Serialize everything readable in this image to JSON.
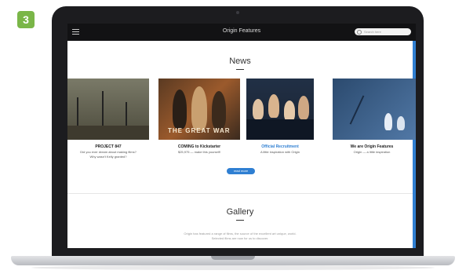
{
  "step_badge": "3",
  "app": {
    "brand": "Origin Features",
    "search_placeholder": "Search here"
  },
  "news": {
    "heading": "News",
    "read_more": "read more",
    "cards": [
      {
        "title": "PROJECT 847",
        "subtitle_1": "Did you ever dream about making films?",
        "subtitle_2": "Why wasn't Kelly granted?",
        "image_icon": "film-still-icon"
      },
      {
        "title": "COMING to Kickstarter",
        "subtitle_1": "$25,975 — make this yourself!",
        "subtitle_2": "",
        "image_icon": "film-poster-icon",
        "image_text": "THE GREAT WAR"
      },
      {
        "title": "Official Recruitment",
        "subtitle_1": "A little inspiration with Origin",
        "subtitle_2": "",
        "image_icon": "audience-photo-icon"
      },
      {
        "title": "We are Origin Features",
        "subtitle_1": "Origin — a little inspiration",
        "subtitle_2": "",
        "image_icon": "film-crew-icon"
      }
    ]
  },
  "gallery": {
    "heading": "Gallery",
    "text_1": "Origin has featured a range of films, the source of the excellent art unique, world.",
    "text_2": "Selected films are now for us to discover."
  },
  "colors": {
    "accent": "#2f7fd2",
    "badge": "#7ab648",
    "navbar": "#121214"
  }
}
